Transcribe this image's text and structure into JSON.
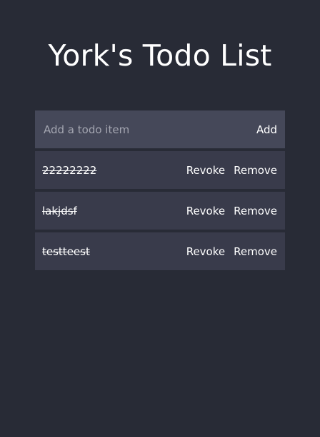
{
  "app": {
    "title": "York's Todo List"
  },
  "new_todo": {
    "placeholder": "Add a todo item",
    "value": "",
    "add_label": "Add"
  },
  "todos": [
    {
      "text": "22222222",
      "completed": true,
      "revoke_label": "Revoke",
      "remove_label": "Remove"
    },
    {
      "text": "lakjdsf",
      "completed": true,
      "revoke_label": "Revoke",
      "remove_label": "Remove"
    },
    {
      "text": "testteest",
      "completed": true,
      "revoke_label": "Revoke",
      "remove_label": "Remove"
    }
  ],
  "colors": {
    "background": "#282b36",
    "input_bg": "#454859",
    "item_bg": "#393b4b",
    "text": "#ffffff"
  }
}
